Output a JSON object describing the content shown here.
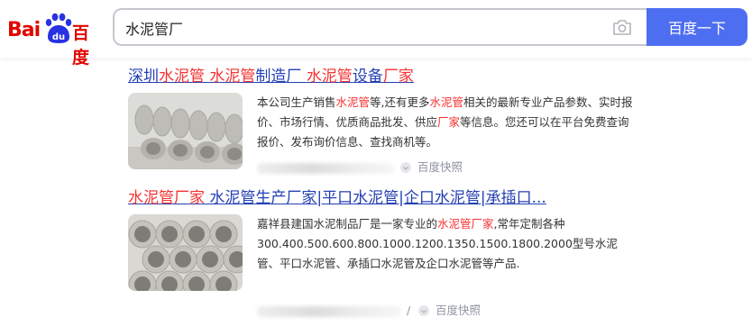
{
  "header": {
    "logo": {
      "bai": "Bai",
      "du": "du",
      "cn": "百度"
    },
    "search": {
      "value": "水泥管厂"
    },
    "search_button": "百度一下",
    "icons": {
      "camera": "camera-icon",
      "paw": "baidu-paw-logo-icon"
    }
  },
  "colors": {
    "brand_red": "#e10601",
    "button_blue": "#4e6ef2",
    "link_blue": "#2440b3",
    "highlight_red": "#f73131",
    "meta_gray": "#9195a3"
  },
  "results": [
    {
      "title_parts": [
        {
          "text": "深圳",
          "hl": false
        },
        {
          "text": "水泥管",
          "hl": true
        },
        {
          "text": " ",
          "hl": false
        },
        {
          "text": "水泥管",
          "hl": true
        },
        {
          "text": "制造厂 ",
          "hl": false
        },
        {
          "text": "水泥管",
          "hl": true
        },
        {
          "text": "设备",
          "hl": false
        },
        {
          "text": "厂家",
          "hl": true
        }
      ],
      "snippet_parts": [
        {
          "text": "本公司生产销售",
          "hl": false
        },
        {
          "text": "水泥管",
          "hl": true
        },
        {
          "text": "等,还有更多",
          "hl": false
        },
        {
          "text": "水泥管",
          "hl": true
        },
        {
          "text": "相关的最新专业产品参数、实时报价、市场行情、优质商品批发、供应",
          "hl": false
        },
        {
          "text": "厂家",
          "hl": true
        },
        {
          "text": "等信息。您还可以在平台免费查询报价、发布询价信息、查找商机等。",
          "hl": false
        }
      ],
      "snapshot_label": "百度快照",
      "icon": "shield-icon"
    },
    {
      "title_parts": [
        {
          "text": "水泥管厂家",
          "hl": true
        },
        {
          "text": " 水泥管生产厂家|平口水泥管|企口水泥管|承插口...",
          "hl": false
        }
      ],
      "snippet_parts": [
        {
          "text": "嘉祥县建国水泥制品厂是一家专业的",
          "hl": false
        },
        {
          "text": "水泥管厂家",
          "hl": true
        },
        {
          "text": ",常年定制各种300.400.500.600.800.1000.1200.1350.1500.1800.2000型号水泥管、平口水泥管、承插口水泥管及企口水泥管等产品.",
          "hl": false
        }
      ],
      "snapshot_prefix": "/",
      "snapshot_label": "百度快照",
      "icon": "shield-icon"
    }
  ]
}
